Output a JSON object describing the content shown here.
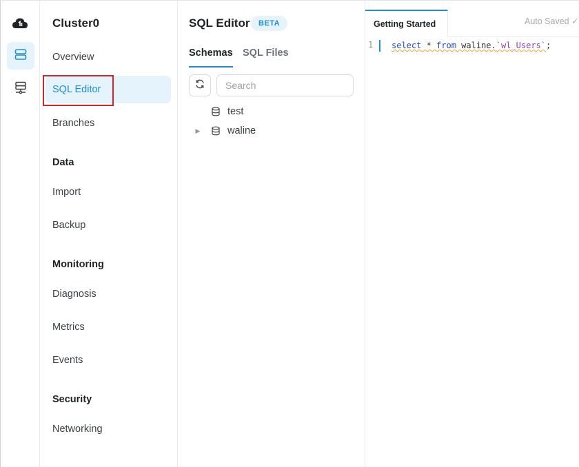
{
  "cluster": {
    "name": "Cluster0"
  },
  "nav": {
    "overview": "Overview",
    "sql_editor": "SQL Editor",
    "branches": "Branches",
    "section_data": "Data",
    "import": "Import",
    "backup": "Backup",
    "section_monitoring": "Monitoring",
    "diagnosis": "Diagnosis",
    "metrics": "Metrics",
    "events": "Events",
    "section_security": "Security",
    "networking": "Networking"
  },
  "schema_panel": {
    "title": "SQL Editor",
    "badge": "BETA",
    "tabs": {
      "schemas": "Schemas",
      "sql_files": "SQL Files"
    },
    "search_placeholder": "Search",
    "databases": [
      {
        "name": "test",
        "expandable": false
      },
      {
        "name": "waline",
        "expandable": true
      }
    ]
  },
  "editor": {
    "tab": "Getting Started",
    "status": "Auto Saved ✓",
    "line_number": "1",
    "code": {
      "kw_select": "select",
      "star": " * ",
      "kw_from": "from",
      "db": " waline.",
      "table": "`wl_Users`",
      "end": ";"
    }
  },
  "colors": {
    "accent": "#1d8ed4",
    "active_bg": "#e4f3fc",
    "highlight": "#d3262b"
  }
}
